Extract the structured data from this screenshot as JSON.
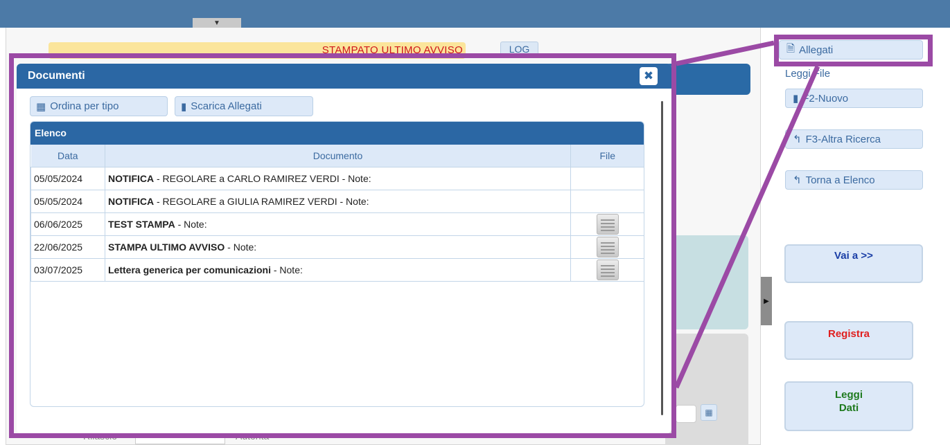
{
  "background": {
    "banner_text": "STAMPATO ULTIMO AVVISO",
    "log_button": "LOG",
    "bottom_label_1": "Rilascio",
    "bottom_label_2": "Autorità"
  },
  "right_panel": {
    "allegati": "Allegati",
    "leggi_file": "Leggi File",
    "nuovo": "F2-Nuovo",
    "altra_ricerca": "F3-Altra Ricerca",
    "torna_elenco": "Torna a Elenco",
    "vai_a": "Vai a >>",
    "registra": "Registra",
    "leggi_dati_1": "Leggi",
    "leggi_dati_2": "Dati"
  },
  "modal": {
    "title": "Documenti",
    "close": "✖",
    "toolbar": {
      "ordina": "Ordina per tipo",
      "scarica": "Scarica Allegati"
    },
    "panel_title": "Elenco",
    "columns": [
      "Data",
      "Documento",
      "File"
    ],
    "rows": [
      {
        "date": "05/05/2024",
        "doc_bold": "NOTIFICA",
        "doc_rest": " - REGOLARE a CARLO  RAMIREZ VERDI  - Note:",
        "has_file": false
      },
      {
        "date": "05/05/2024",
        "doc_bold": "NOTIFICA",
        "doc_rest": " - REGOLARE a GIULIA RAMIREZ VERDI - Note:",
        "has_file": false
      },
      {
        "date": "06/06/2025",
        "doc_bold": "TEST STAMPA",
        "doc_rest": " - Note:",
        "has_file": true
      },
      {
        "date": "22/06/2025",
        "doc_bold": "STAMPA ULTIMO AVVISO",
        "doc_rest": " - Note:",
        "has_file": true
      },
      {
        "date": "03/07/2025",
        "doc_bold": "Lettera generica per comunicazioni",
        "doc_rest": " - Note:",
        "has_file": true
      }
    ]
  },
  "colors": {
    "header_blue": "#2b67a4",
    "highlight_purple": "#9b4aa5",
    "registra_red": "#e02020",
    "leggi_green": "#1e7a1e"
  }
}
